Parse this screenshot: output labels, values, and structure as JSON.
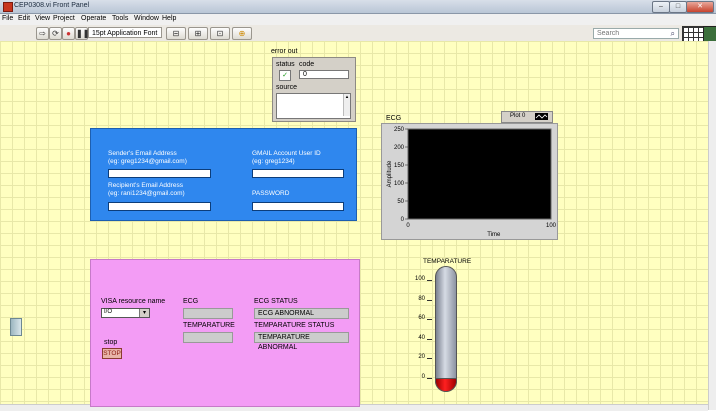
{
  "window": {
    "title": "CEP0308.vi Front Panel",
    "controls": [
      "–",
      "□",
      "✕"
    ]
  },
  "menu": [
    "File",
    "Edit",
    "View",
    "Project",
    "Operate",
    "Tools",
    "Window",
    "Help"
  ],
  "toolbar": {
    "font_select": "15pt Application Font",
    "search_placeholder": "Search"
  },
  "error_out": {
    "label": "error out",
    "status_label": "status",
    "code_label": "code",
    "code_value": "0",
    "source_label": "source",
    "status_ok": true
  },
  "email": {
    "sender_label": "Sender's Email Address",
    "sender_hint": "(eg: greg1234@gmail.com)",
    "sender_value": "",
    "recipient_label": "Recipient's Email Address",
    "recipient_hint": "(eg: rani1234@gmail.com)",
    "recipient_value": "",
    "gmail_label": "GMAIL Account User ID",
    "gmail_hint": "(eg: greg1234)",
    "gmail_value": "",
    "password_label": "PASSWORD",
    "password_value": ""
  },
  "instruments": {
    "visa_label": "VISA resource name",
    "visa_value": "",
    "ecg_label": "ECG",
    "ecg_value": "",
    "temp_label": "TEMPARATURE",
    "temp_value": "",
    "ecg_status_label": "ECG STATUS",
    "ecg_status_value": "ECG ABNORMAL",
    "temp_status_label": "TEMPARATURE STATUS",
    "temp_status_value": "TEMPARATURE ABNORMAL",
    "stop_label": "stop",
    "stop_button": "STOP"
  },
  "thermometer": {
    "label": "TEMPARATURE",
    "ticks": [
      "100",
      "80",
      "60",
      "40",
      "20",
      "0"
    ],
    "value": 0,
    "range": [
      0,
      100
    ]
  },
  "chart_data": {
    "type": "line",
    "title": "ECG",
    "xlabel": "Time",
    "ylabel": "Amplitude",
    "legend": "Plot 0",
    "xlim": [
      0,
      100
    ],
    "ylim": [
      0,
      250
    ],
    "x_ticks": [
      "0",
      "100"
    ],
    "y_ticks": [
      "250",
      "200",
      "150",
      "100",
      "50",
      "0"
    ],
    "series": [
      {
        "name": "Plot 0",
        "x": [],
        "y": []
      }
    ],
    "plot_bg": "#000000"
  }
}
